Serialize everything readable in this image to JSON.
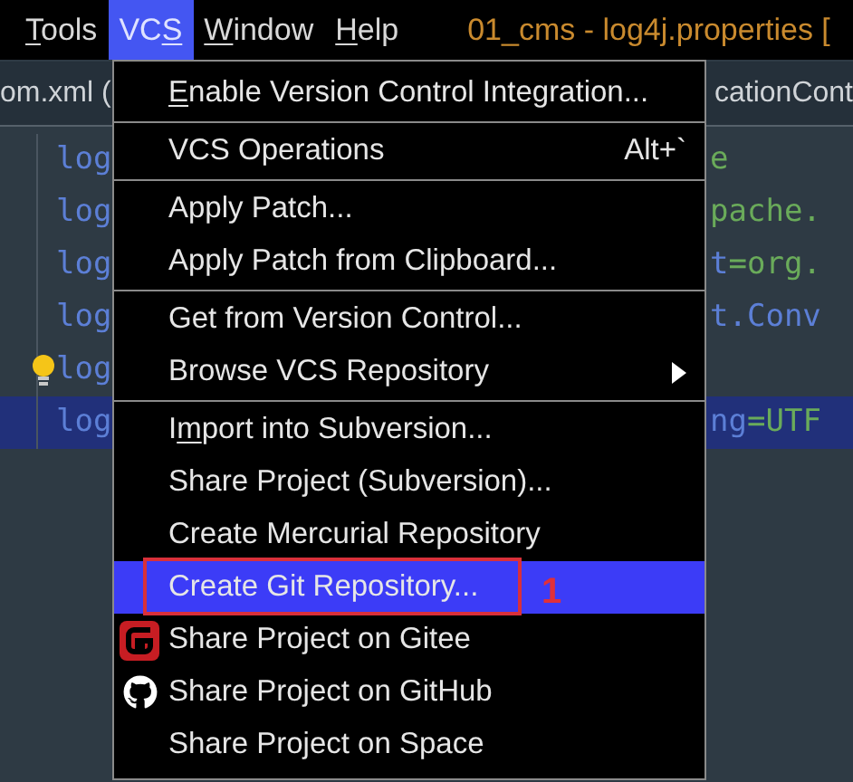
{
  "menubar": {
    "items": [
      {
        "parts": [
          {
            "text": "T",
            "underlined": true
          },
          {
            "text": "ools",
            "underlined": false
          }
        ],
        "selected": false
      },
      {
        "parts": [
          {
            "text": "VC",
            "underlined": false
          },
          {
            "text": "S",
            "underlined": true
          }
        ],
        "selected": true
      },
      {
        "parts": [
          {
            "text": "W",
            "underlined": true
          },
          {
            "text": "indow",
            "underlined": false
          }
        ],
        "selected": false
      },
      {
        "parts": [
          {
            "text": "H",
            "underlined": true
          },
          {
            "text": "elp",
            "underlined": false
          }
        ],
        "selected": false
      }
    ],
    "title": "01_cms - log4j.properties ["
  },
  "tabs": {
    "left": "om.xml (",
    "right": "cationCont"
  },
  "code_lines": [
    {
      "left": "log",
      "right": [
        {
          "text": "e",
          "kind": "value"
        }
      ],
      "selected": false,
      "bulb": false
    },
    {
      "left": "log",
      "right": [
        {
          "text": "pache.",
          "kind": "value"
        }
      ],
      "selected": false,
      "bulb": false
    },
    {
      "left": "log",
      "right": [
        {
          "text": "t",
          "kind": "key"
        },
        {
          "text": "=org.",
          "kind": "value"
        }
      ],
      "selected": false,
      "bulb": false
    },
    {
      "left": "log",
      "right": [
        {
          "text": "t.Conv",
          "kind": "key"
        }
      ],
      "selected": false,
      "bulb": false
    },
    {
      "left": "log",
      "selected": false,
      "bulb": true
    },
    {
      "left": "log",
      "right": [
        {
          "text": "ng",
          "kind": "key"
        },
        {
          "text": "=UTF",
          "kind": "value"
        }
      ],
      "selected": true,
      "bulb": false
    }
  ],
  "menu": {
    "items": [
      {
        "kind": "item",
        "parts": [
          {
            "text": "E",
            "underlined": true
          },
          {
            "text": "nable Version Control Integration...",
            "underlined": false
          }
        ],
        "selected": false
      },
      {
        "kind": "separator"
      },
      {
        "kind": "item",
        "label": "VCS Operations",
        "shortcut": "Alt+`",
        "selected": false
      },
      {
        "kind": "separator"
      },
      {
        "kind": "item",
        "label": "Apply Patch...",
        "selected": false
      },
      {
        "kind": "item",
        "label": "Apply Patch from Clipboard...",
        "selected": false
      },
      {
        "kind": "separator"
      },
      {
        "kind": "item",
        "label": "Get from Version Control...",
        "selected": false
      },
      {
        "kind": "item",
        "label": "Browse VCS Repository",
        "submenu": true,
        "selected": false
      },
      {
        "kind": "separator"
      },
      {
        "kind": "item",
        "parts": [
          {
            "text": "I",
            "underlined": false
          },
          {
            "text": "m",
            "underlined": true
          },
          {
            "text": "port into Subversion...",
            "underlined": false
          }
        ],
        "selected": false
      },
      {
        "kind": "item",
        "label": "Share Project (Subversion)...",
        "selected": false
      },
      {
        "kind": "item",
        "label": "Create Mercurial Repository",
        "selected": false
      },
      {
        "kind": "item",
        "label": "Create Git Repository...",
        "selected": true,
        "callout": "1"
      },
      {
        "kind": "gitee",
        "label": "Share Project on Gitee",
        "selected": false
      },
      {
        "kind": "github",
        "label": "Share Project on GitHub",
        "selected": false
      },
      {
        "kind": "item",
        "label": "Share Project on Space",
        "selected": false
      }
    ]
  }
}
